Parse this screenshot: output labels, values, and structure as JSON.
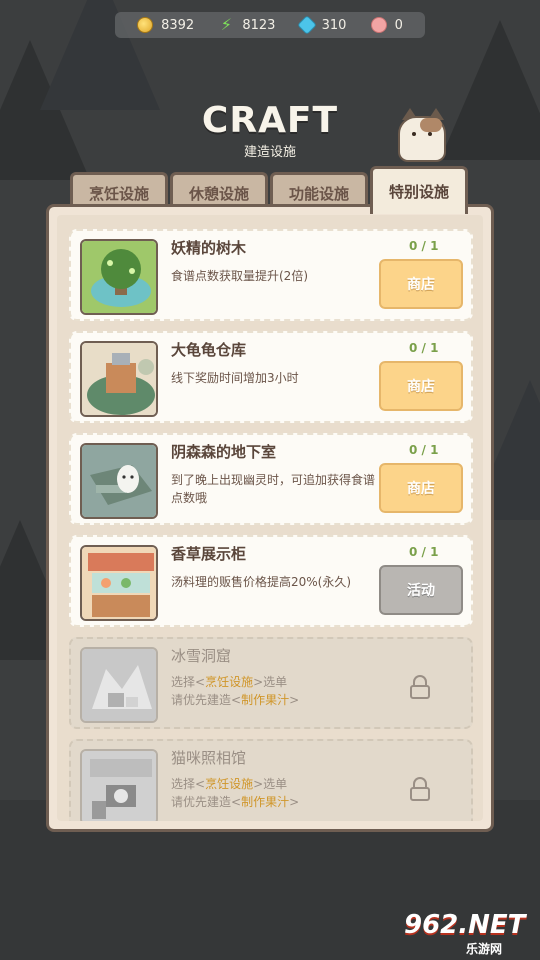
{
  "resources": [
    {
      "icon": "coin-icon",
      "value": "8392"
    },
    {
      "icon": "energy-bolt-icon",
      "value": "8123"
    },
    {
      "icon": "gem-icon",
      "value": "310"
    },
    {
      "icon": "pig-coin-icon",
      "value": "0"
    }
  ],
  "header": {
    "title": "CRAFT",
    "subtitle": "建造设施"
  },
  "tabs": [
    {
      "label": "烹饪设施",
      "active": false
    },
    {
      "label": "休憩设施",
      "active": false
    },
    {
      "label": "功能设施",
      "active": false
    },
    {
      "label": "特别设施",
      "active": true
    }
  ],
  "facilities": [
    {
      "name": "妖精的树木",
      "desc": "食谱点数获取量提升(2倍)",
      "count": "0 / 1",
      "button": "商店"
    },
    {
      "name": "大龟龟仓库",
      "desc": "线下奖励时间增加3小时",
      "count": "0 / 1",
      "button": "商店"
    },
    {
      "name": "阴森森的地下室",
      "desc": "到了晚上出现幽灵时，可追加获得食谱点数哦",
      "count": "0 / 1",
      "button": "商店"
    },
    {
      "name": "香草展示柜",
      "desc": "汤料理的贩售价格提高20%(永久)",
      "count": "0 / 1",
      "button": "活动"
    },
    {
      "name": "冰雪洞窟",
      "line1_pre": "选择<",
      "line1_hl": "烹饪设施",
      "line1_post": ">选单",
      "line2_pre": "请优先建造<",
      "line2_hl": "制作果汁",
      "line2_post": ">"
    },
    {
      "name": "猫咪照相馆",
      "line1_pre": "选择<",
      "line1_hl": "烹饪设施",
      "line1_post": ">选单",
      "line2_pre": "请优先建造<",
      "line2_hl": "制作果汁",
      "line2_post": ">"
    }
  ],
  "watermark": {
    "main": "962.NET",
    "sub": "乐游网"
  },
  "colors": {
    "shop_button": "#fcd48a",
    "event_button": "#b9b6b2",
    "panel": "#f0e4d6",
    "count_green": "#7aa04a",
    "highlight": "#d0962a"
  }
}
